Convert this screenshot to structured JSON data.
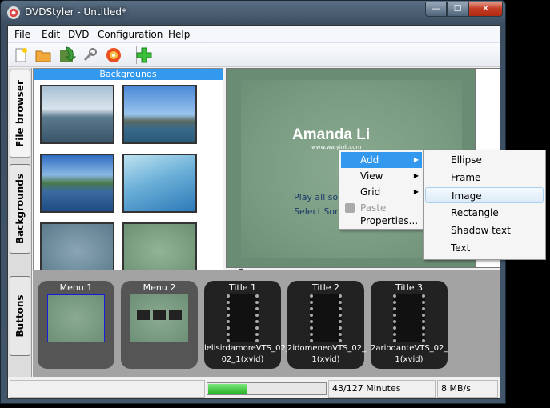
{
  "window": {
    "title": "DVDStyler - Untitled*",
    "min": "—",
    "max": "☐",
    "close": "✕"
  },
  "menubar": [
    "File",
    "Edit",
    "DVD",
    "Configuration",
    "Help"
  ],
  "toolbar": {
    "icons": [
      "new-icon",
      "open-icon",
      "save-icon",
      "settings-wrench-icon",
      "burn-dvd-icon",
      "add-icon"
    ]
  },
  "side_tabs": {
    "file_browser": "File browser",
    "backgrounds": "Backgrounds",
    "buttons": "Buttons"
  },
  "backgrounds_panel": {
    "header": "Backgrounds"
  },
  "canvas": {
    "title": "Amanda Li",
    "url": "www.waiyinli.com",
    "links": [
      "Play all songs",
      "Select Song"
    ]
  },
  "context_menu": {
    "items": [
      {
        "label": "Add",
        "submenu": true,
        "highlighted": true,
        "disabled": false
      },
      {
        "label": "View",
        "submenu": true,
        "highlighted": false,
        "disabled": false
      },
      {
        "label": "Grid",
        "submenu": true,
        "highlighted": false,
        "disabled": false
      },
      {
        "label": "Paste",
        "submenu": false,
        "highlighted": false,
        "disabled": true
      },
      {
        "label": "Properties...",
        "submenu": false,
        "highlighted": false,
        "disabled": false
      }
    ]
  },
  "add_submenu": {
    "items": [
      "Ellipse",
      "Frame",
      "Image",
      "Rectangle",
      "Shadow text",
      "Text"
    ],
    "hovered": "Image"
  },
  "titleset": [
    {
      "label": "Menu 1",
      "kind": "menu",
      "sub": ""
    },
    {
      "label": "Menu 2",
      "kind": "menu",
      "sub": ""
    },
    {
      "label": "Title 1",
      "kind": "title",
      "sub": "lelisirdamoreVTS_02_ 02_1(xvid)"
    },
    {
      "label": "Title 2",
      "kind": "title",
      "sub": "2idomeneoVTS_02_ 1(xvid)"
    },
    {
      "label": "Title 3",
      "kind": "title",
      "sub": "2ariodanteVTS_02_ 1(xvid)"
    }
  ],
  "status": {
    "progress_text": "43/127 Minutes",
    "progress_fraction": 0.3386,
    "rate": "8 MB/s"
  },
  "colors": {
    "accent": "#3399ee",
    "progress": "#2bb42b",
    "canvas": "#7a9c82"
  }
}
